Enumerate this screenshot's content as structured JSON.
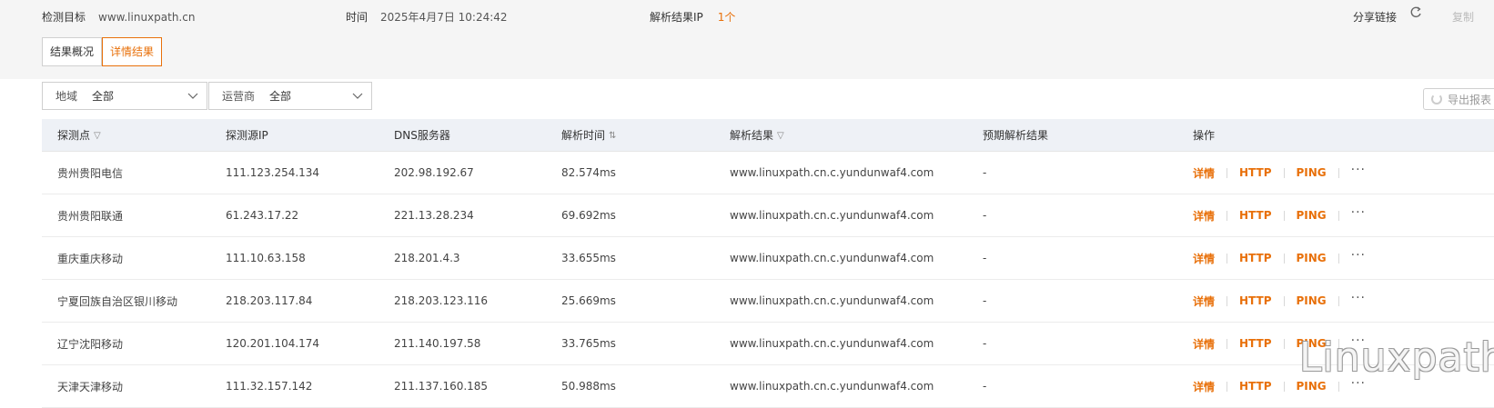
{
  "header": {
    "target_label": "检测目标",
    "target_value": "www.linuxpath.cn",
    "time_label": "时间",
    "time_value": "2025年4月7日 10:24:42",
    "ip_label": "解析结果IP",
    "ip_value": "1个",
    "share_label": "分享链接",
    "refresh_icon": "refresh-icon",
    "copy_label": "复制"
  },
  "tabs": [
    {
      "label": "结果概况",
      "active": false
    },
    {
      "label": "详情结果",
      "active": true
    }
  ],
  "filters": {
    "region_label": "地域",
    "region_value": "全部",
    "isp_label": "运营商",
    "isp_value": "全部"
  },
  "export_label": "导出报表",
  "table": {
    "columns": [
      "探测点",
      "探测源IP",
      "DNS服务器",
      "解析时间",
      "解析结果",
      "预期解析结果",
      "操作"
    ],
    "rows": [
      {
        "point": "贵州贵阳电信",
        "src_ip": "111.123.254.134",
        "dns": "202.98.192.67",
        "time": "82.574ms",
        "result": "www.linuxpath.cn.c.yundunwaf4.com",
        "expected": "-"
      },
      {
        "point": "贵州贵阳联通",
        "src_ip": "61.243.17.22",
        "dns": "221.13.28.234",
        "time": "69.692ms",
        "result": "www.linuxpath.cn.c.yundunwaf4.com",
        "expected": "-"
      },
      {
        "point": "重庆重庆移动",
        "src_ip": "111.10.63.158",
        "dns": "218.201.4.3",
        "time": "33.655ms",
        "result": "www.linuxpath.cn.c.yundunwaf4.com",
        "expected": "-"
      },
      {
        "point": "宁夏回族自治区银川移动",
        "src_ip": "218.203.117.84",
        "dns": "218.203.123.116",
        "time": "25.669ms",
        "result": "www.linuxpath.cn.c.yundunwaf4.com",
        "expected": "-"
      },
      {
        "point": "辽宁沈阳移动",
        "src_ip": "120.201.104.174",
        "dns": "211.140.197.58",
        "time": "33.765ms",
        "result": "www.linuxpath.cn.c.yundunwaf4.com",
        "expected": "-"
      },
      {
        "point": "天津天津移动",
        "src_ip": "111.32.157.142",
        "dns": "211.137.160.185",
        "time": "50.988ms",
        "result": "www.linuxpath.cn.c.yundunwaf4.com",
        "expected": "-"
      }
    ],
    "ops": {
      "detail": "详情",
      "http": "HTTP",
      "ping": "PING",
      "more": "···"
    }
  },
  "watermark": "Linuxpath",
  "colors": {
    "accent": "#e8700a",
    "header_bg": "#f5f5f5",
    "table_head_bg": "#eef1f6"
  }
}
